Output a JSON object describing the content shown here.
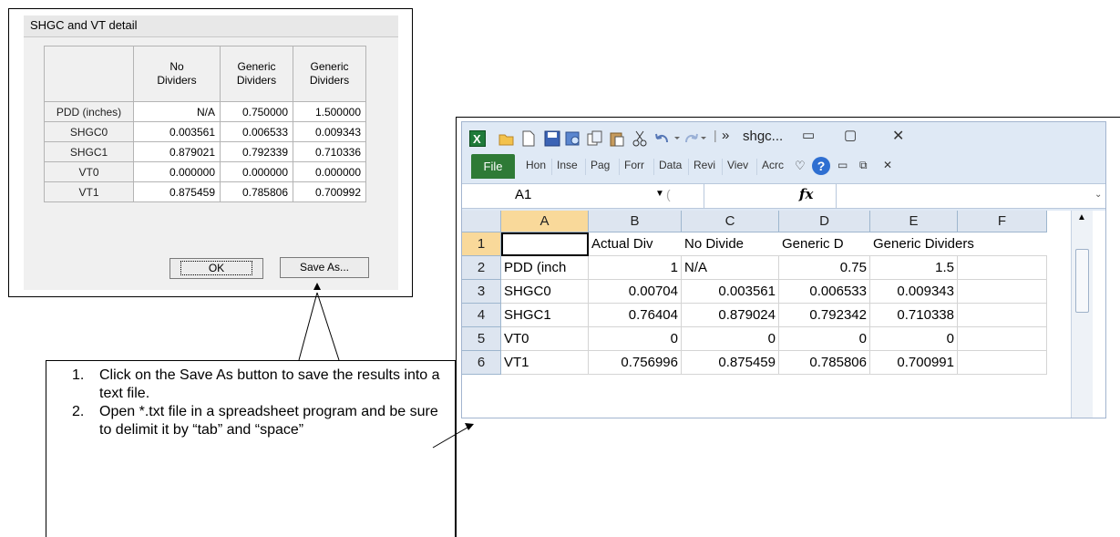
{
  "dialog": {
    "title": "SHGC and VT detail",
    "columns": [
      "No\nDividers",
      "Generic\nDividers",
      "Generic\nDividers"
    ],
    "rows": [
      {
        "label": "PDD (inches)",
        "values": [
          "N/A",
          "0.750000",
          "1.500000"
        ]
      },
      {
        "label": "SHGC0",
        "values": [
          "0.003561",
          "0.006533",
          "0.009343"
        ]
      },
      {
        "label": "SHGC1",
        "values": [
          "0.879021",
          "0.792339",
          "0.710336"
        ]
      },
      {
        "label": "VT0",
        "values": [
          "0.000000",
          "0.000000",
          "0.000000"
        ]
      },
      {
        "label": "VT1",
        "values": [
          "0.875459",
          "0.785806",
          "0.700992"
        ]
      }
    ],
    "ok_label": "OK",
    "saveas_label": "Save As..."
  },
  "callout": {
    "items": [
      {
        "num": "1.",
        "text": "Click on the Save As button to save the results into a text file."
      },
      {
        "num": "2.",
        "text": "Open *.txt file in a spreadsheet program and be sure to delimit it by “tab” and “space”"
      }
    ]
  },
  "excel": {
    "title": "shgc...",
    "title_arrow": "»",
    "file_tab": "File",
    "tabs": [
      "Hon",
      "Inse",
      "Pag",
      "Forr",
      "Data",
      "Revi",
      "Viev",
      "Acrc"
    ],
    "name_box": "A1",
    "fx": "fx",
    "columns": [
      "A",
      "B",
      "C",
      "D",
      "E",
      "F"
    ],
    "rows": [
      {
        "num": "1",
        "cells": [
          "",
          "Actual Div",
          "No Divide",
          "Generic D",
          "Generic Dividers",
          ""
        ]
      },
      {
        "num": "2",
        "cells": [
          "PDD (inch",
          "1",
          "N/A",
          "0.75",
          "1.5",
          ""
        ]
      },
      {
        "num": "3",
        "cells": [
          "SHGC0",
          "0.00704",
          "0.003561",
          "0.006533",
          "0.009343",
          ""
        ]
      },
      {
        "num": "4",
        "cells": [
          "SHGC1",
          "0.76404",
          "0.879024",
          "0.792342",
          "0.710338",
          ""
        ]
      },
      {
        "num": "5",
        "cells": [
          "VT0",
          "0",
          "0",
          "0",
          "0",
          ""
        ]
      },
      {
        "num": "6",
        "cells": [
          "VT1",
          "0.756996",
          "0.875459",
          "0.785806",
          "0.700991",
          ""
        ]
      }
    ],
    "colors": {
      "file_tab": "#2e7a36",
      "selected_header": "#f9d99a",
      "header": "#dde5f0"
    }
  }
}
